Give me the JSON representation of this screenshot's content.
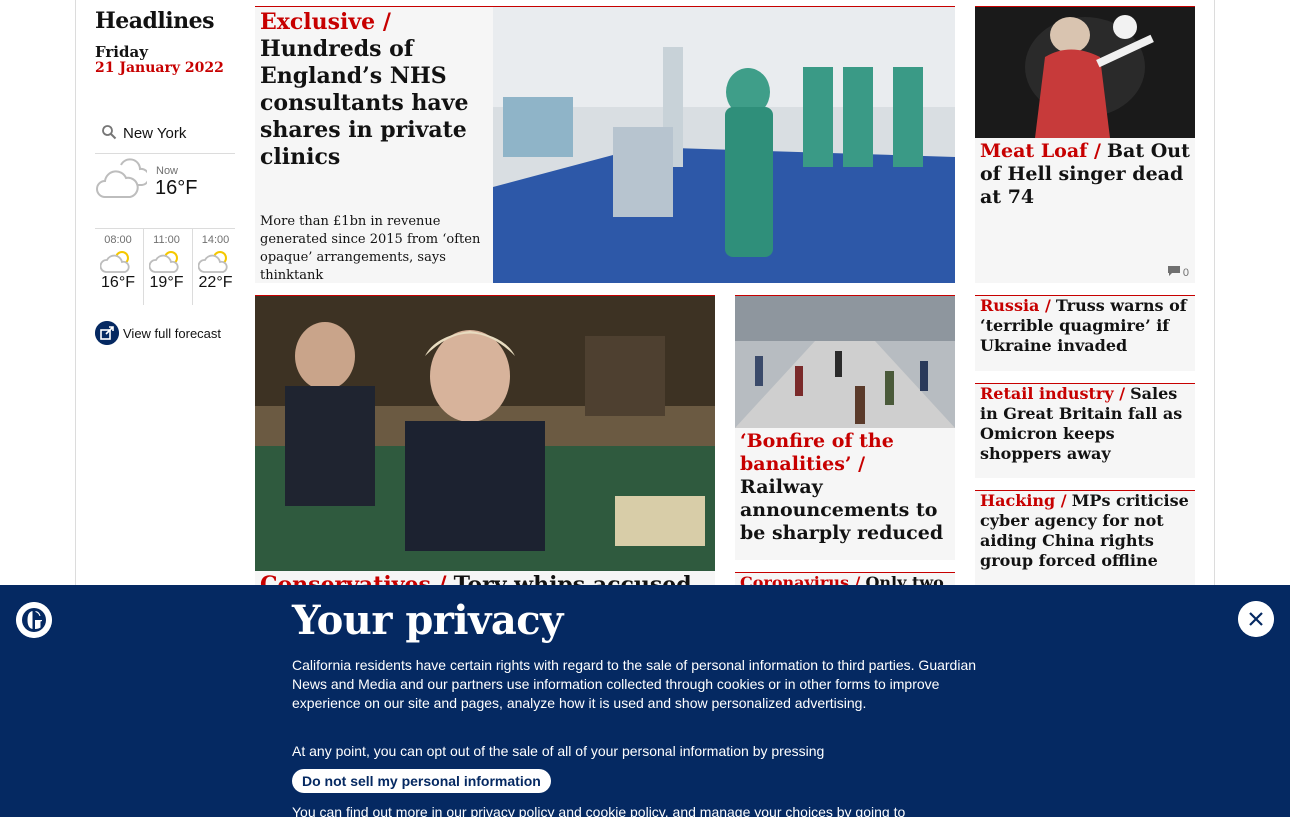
{
  "sidebar": {
    "title": "Headlines",
    "day": "Friday",
    "date": "21 January 2022",
    "weather": {
      "location": "New York",
      "now_label": "Now",
      "now_temp": "16°F",
      "forecast": [
        {
          "time": "08:00",
          "temp": "16°F"
        },
        {
          "time": "11:00",
          "temp": "19°F"
        },
        {
          "time": "14:00",
          "temp": "22°F"
        }
      ],
      "view_full_forecast": "View full forecast"
    }
  },
  "stories": {
    "main": {
      "kicker": "Exclusive /",
      "headline": "Hundreds of England’s NHS consultants have shares in private clinics",
      "standfirst": "More than £1bn in revenue generated since 2015 from ‘often opaque’ arrangements, says thinktank"
    },
    "boris": {
      "kicker": "Conservatives /",
      "headline": "Tory whips accused of"
    },
    "rail": {
      "kicker": "‘Bonfire of the banalities’ /",
      "headline": "Railway announcements to be sharply reduced"
    },
    "corona": {
      "kicker": "Coronavirus /",
      "headline": "Only two"
    },
    "meat": {
      "kicker": "Meat Loaf /",
      "headline": "Bat Out of Hell singer dead at 74",
      "comments": "0"
    },
    "russia": {
      "kicker": "Russia /",
      "headline": "Truss warns of ‘terrible quagmire’ if Ukraine invaded"
    },
    "retail": {
      "kicker": "Retail industry /",
      "headline": "Sales in Great Britain fall as Omicron keeps shoppers away"
    },
    "hacking": {
      "kicker": "Hacking /",
      "headline": "MPs criticise cyber agency for not aiding China rights group forced offline"
    }
  },
  "privacy": {
    "title": "Your privacy",
    "p1": "California residents have certain rights with regard to the sale of personal information to third parties. Guardian News and Media and our partners use information collected through cookies or in other forms to improve experience on our site and pages, analyze how it is used and show personalized advertising.",
    "p2": "At any point, you can opt out of the sale of all of your personal information by pressing",
    "button": "Do not sell my personal information",
    "p3": "You can find out more in our privacy policy and cookie policy, and manage your choices by going to"
  },
  "colors": {
    "brand_navy": "#052962",
    "kicker_red": "#c70000"
  }
}
